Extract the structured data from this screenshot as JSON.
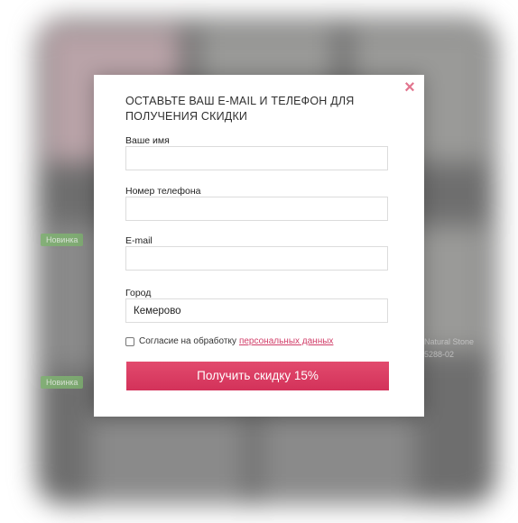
{
  "background": {
    "badges": [
      "Новинка",
      "Новинка"
    ],
    "product_text_1": "Natural Stone",
    "product_text_2": "5288-02"
  },
  "modal": {
    "close_symbol": "×",
    "title": "ОСТАВЬТЕ ВАШ E-MAIL И ТЕЛЕФОН ДЛЯ ПОЛУЧЕНИЯ СКИДКИ",
    "fields": {
      "name": {
        "label": "Ваше имя",
        "value": ""
      },
      "phone": {
        "label": "Номер телефона",
        "value": ""
      },
      "email": {
        "label": "E-mail",
        "value": ""
      },
      "city": {
        "label": "Город",
        "value": "Кемерово"
      }
    },
    "consent": {
      "text": "Согласие на обработку",
      "link": "персональных данных",
      "checked": false
    },
    "submit_label": "Получить скидку 15%"
  },
  "colors": {
    "accent": "#d3325a",
    "close": "#e2758e",
    "badge": "#7fb271"
  }
}
